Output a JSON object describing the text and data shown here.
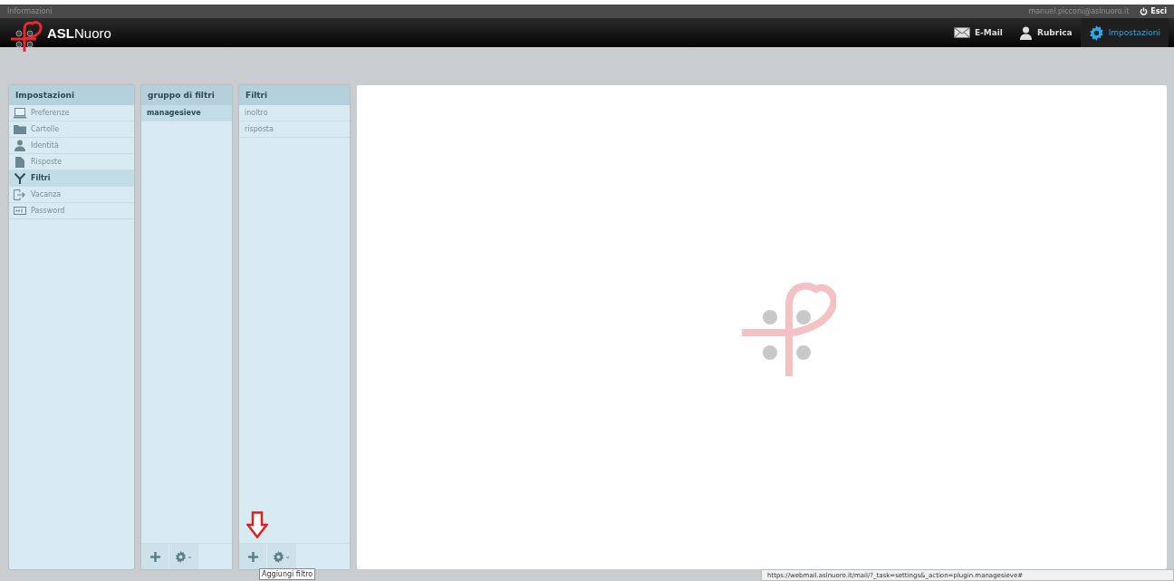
{
  "info_bar": {
    "title": "Informazioni",
    "user": "manuel.picconi@aslnuoro.it",
    "logout": "Esci"
  },
  "header": {
    "brand": "**ASL**Nuoro",
    "nav": [
      {
        "label": "E-Mail",
        "kind": "mail",
        "selected": false
      },
      {
        "label": "Rubrica",
        "kind": "person",
        "selected": false
      },
      {
        "label": "Impostazioni",
        "kind": "gear",
        "selected": true
      }
    ]
  },
  "settings_panel": {
    "title": "Impostazioni",
    "items": [
      {
        "label": "Preferenze",
        "kind": "monitor",
        "selected": false
      },
      {
        "label": "Cartelle",
        "kind": "folder",
        "selected": false
      },
      {
        "label": "Identità",
        "kind": "person",
        "selected": false
      },
      {
        "label": "Risposte",
        "kind": "document",
        "selected": false
      },
      {
        "label": "Filtri",
        "kind": "filter",
        "selected": true
      },
      {
        "label": "Vacanza",
        "kind": "exit",
        "selected": false
      },
      {
        "label": "Password",
        "kind": "password",
        "selected": false
      }
    ]
  },
  "groups_panel": {
    "title": "gruppo di filtri",
    "items": [
      {
        "label": "managesieve",
        "selected": true
      }
    ]
  },
  "filters_panel": {
    "title": "Filtri",
    "items": [
      {
        "label": "inoltro",
        "selected": false
      },
      {
        "label": "risposta",
        "selected": false
      }
    ]
  },
  "tooltip": "Aggiungi filtro",
  "status_url": "https://webmail.aslnuoro.it/mail/?_task=settings&_action=plugin.managesieve#"
}
